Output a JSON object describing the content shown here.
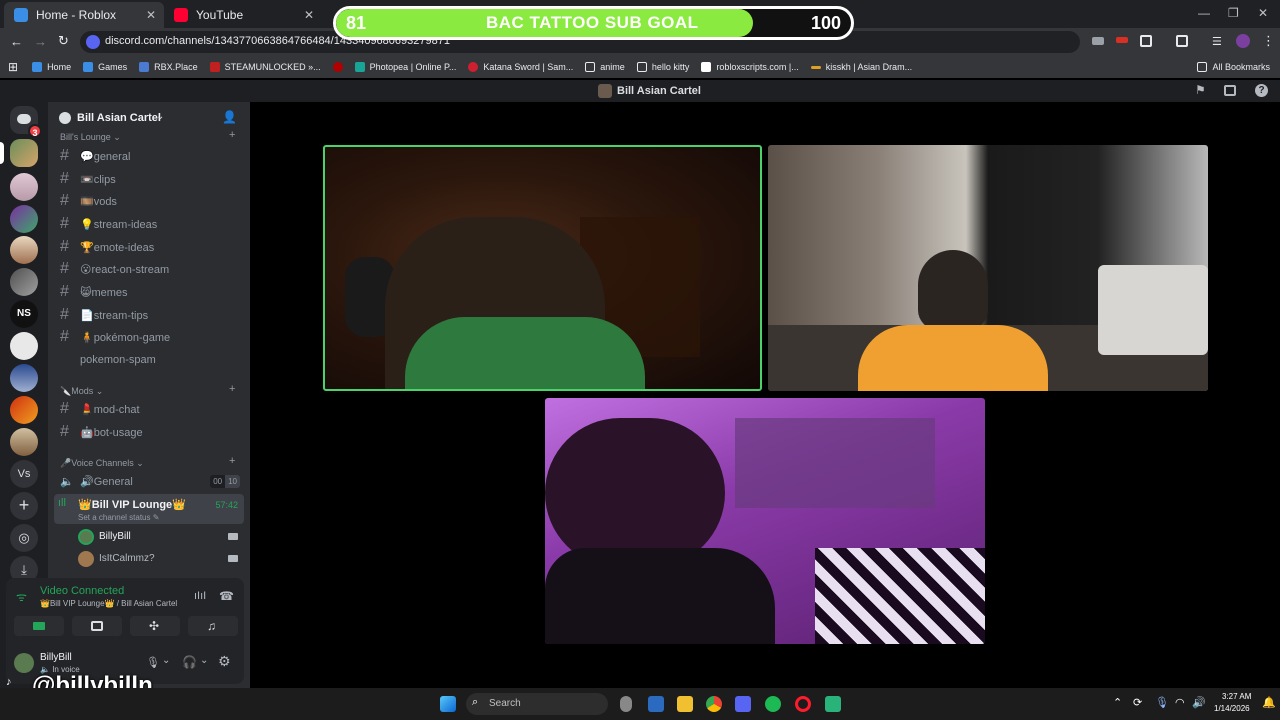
{
  "browser": {
    "tabs": [
      {
        "title": "Home - Roblox",
        "fav": "#3a8ee6"
      },
      {
        "title": "YouTube",
        "fav": "#ff0033"
      }
    ],
    "url": "discord.com/channels/1343770663864766484/1433409680693279871",
    "bookmarks": [
      "Home",
      "Games",
      "RBX.Place",
      "STEAMUNLOCKED »...",
      "Photopea | Online P...",
      "Katana Sword | Sam...",
      "anime",
      "hello kitty",
      "robloxscripts.com |...",
      "kisskh | Asian Dram..."
    ],
    "all_bookmarks": "All Bookmarks"
  },
  "goal": {
    "current": "81",
    "title": "BAC TATTOO SUB GOAL",
    "target": "100",
    "progress": 0.81,
    "color": "#8bea3f"
  },
  "discord": {
    "window_title": "Bill Asian Cartel",
    "server_name": "Bill Asian Cartel",
    "dm_badge": "3",
    "categories": {
      "lounge": "Bill's Lounge",
      "mods": "Mods",
      "voice": "Voice Channels"
    },
    "channels": [
      {
        "name": "💬general"
      },
      {
        "name": "📼clips"
      },
      {
        "name": "🎞️vods"
      },
      {
        "name": "💡stream-ideas"
      },
      {
        "name": "🏆emote-ideas"
      },
      {
        "name": "😮react-on-stream"
      },
      {
        "name": "😸memes"
      },
      {
        "name": "📄stream-tips"
      },
      {
        "name": "🧍pokémon-game"
      },
      {
        "name": "pokemon-spam"
      }
    ],
    "mod_channels": [
      {
        "name": "💄mod-chat"
      },
      {
        "name": "🤖bot-usage"
      }
    ],
    "voice": {
      "general": {
        "name": "🔊General",
        "count_a": "00",
        "count_b": "10"
      },
      "vip": {
        "name": "👑Bill VIP Lounge👑",
        "time": "57:42",
        "status": "Set a channel status"
      },
      "members": [
        "BillyBill",
        "IsItCalmmz?"
      ]
    },
    "connection": {
      "state": "Video Connected",
      "location": "👑Bill VIP Lounge👑 / Bill Asian Cartel"
    },
    "user": {
      "name": "BillyBill",
      "status": "In voice"
    }
  },
  "overlay_handle": "@billybilln",
  "taskbar": {
    "search": "Search",
    "time": "3:27 AM",
    "date": "1/14/2026"
  }
}
